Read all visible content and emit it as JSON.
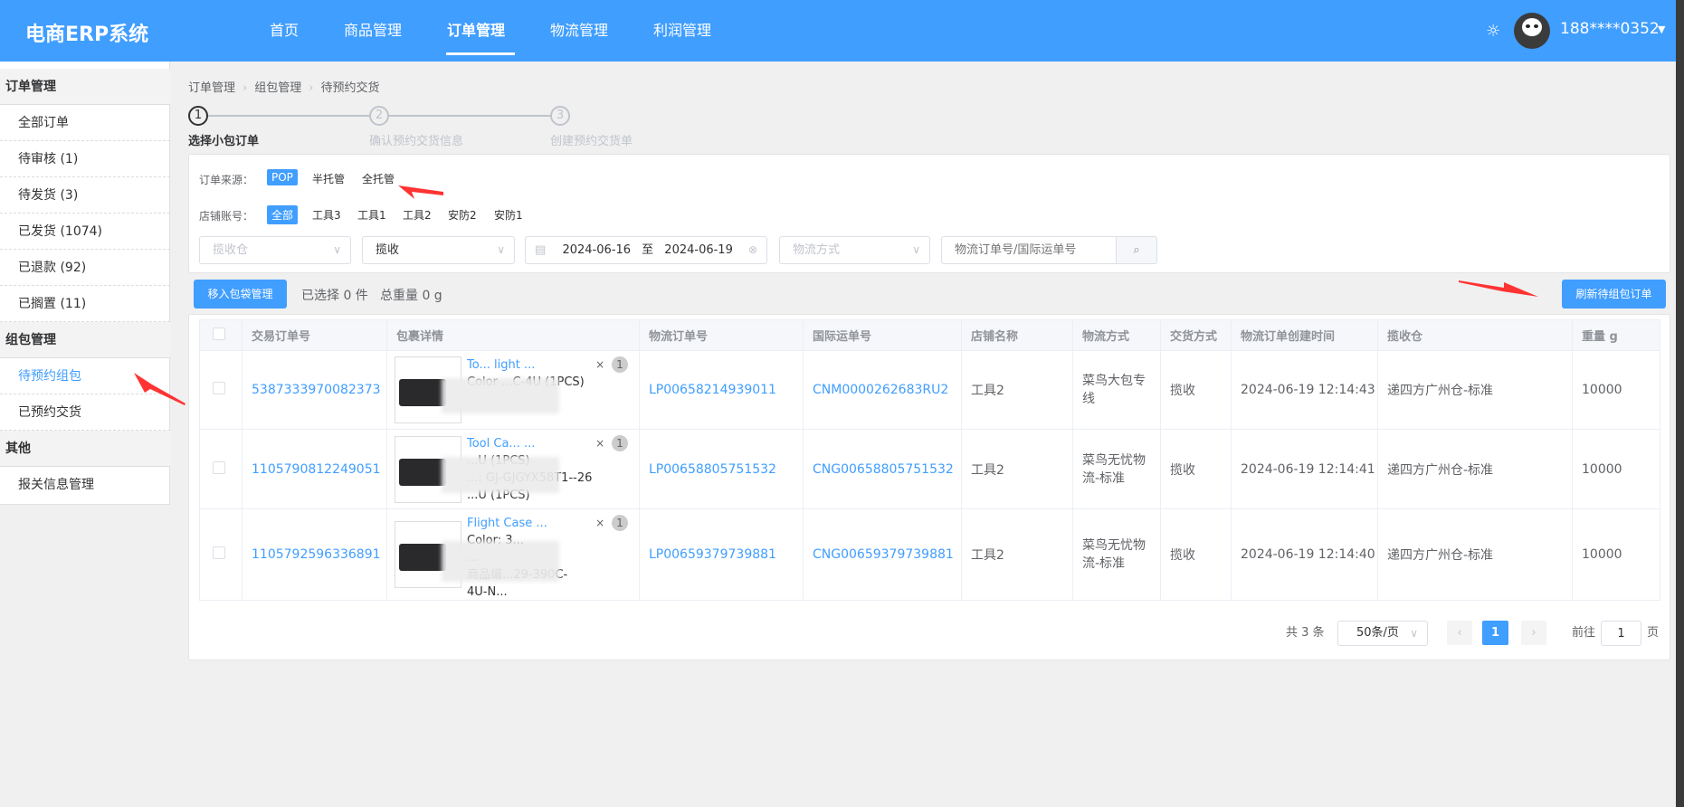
{
  "header": {
    "logo": "电商ERP系统",
    "nav": [
      "首页",
      "商品管理",
      "订单管理",
      "物流管理",
      "利润管理"
    ],
    "active_nav": "订单管理",
    "user": "188****0352",
    "theme_icon": "sun-icon",
    "accent": "#409eff"
  },
  "sidebar": {
    "groups": [
      {
        "label": "订单管理",
        "items": [
          "全部订单",
          "待审核 (1)",
          "待发货 (3)",
          "已发货 (1074)",
          "已退款 (92)",
          "已搁置 (11)"
        ]
      },
      {
        "label": "组包管理",
        "items": [
          "待预约组包",
          "已预约交货"
        ]
      },
      {
        "label": "其他",
        "items": [
          "报关信息管理"
        ]
      }
    ],
    "active": "待预约组包"
  },
  "breadcrumb": [
    "订单管理",
    "组包管理",
    "待预约交货"
  ],
  "steps": [
    {
      "num": "1",
      "label": "选择小包订单"
    },
    {
      "num": "2",
      "label": "确认预约交货信息"
    },
    {
      "num": "3",
      "label": "创建预约交货单"
    }
  ],
  "filters": {
    "source_label": "订单来源：",
    "sources": [
      "POP",
      "半托管",
      "全托管"
    ],
    "source_active": "POP",
    "shop_label": "店铺账号：",
    "shops": [
      "全部",
      "工具3",
      "工具1",
      "工具2",
      "安防2",
      "安防1"
    ],
    "shop_active": "全部",
    "warehouse_placeholder": "揽收仓",
    "delivery_value": "揽收",
    "date_start": "2024-06-16",
    "date_sep": "至",
    "date_end": "2024-06-19",
    "logistics_placeholder": "物流方式",
    "search_placeholder": "物流订单号/国际运单号"
  },
  "actions": {
    "move_button": "移入包袋管理",
    "selected": "已选择 0 件",
    "weight": "总重量 0 g",
    "refresh_button": "刷新待组包订单"
  },
  "table": {
    "columns": [
      "交易订单号",
      "包裹详情",
      "物流订单号",
      "国际运单号",
      "店铺名称",
      "物流方式",
      "交货方式",
      "物流订单创建时间",
      "揽收仓",
      "重量 g"
    ],
    "rows": [
      {
        "trade_no": "5387333970082373",
        "pkg_lines": [
          "To... light ...",
          "Color ...C-4U (1PCS)"
        ],
        "qty": "1",
        "logistics_no": "LP00658214939011",
        "intl_no": "CNM0000262683RU2",
        "shop": "工具2",
        "method": "菜鸟大包专线",
        "delivery": "揽收",
        "created": "2024-06-19 12:14:43",
        "warehouse": "递四方广州仓-标准",
        "weight": "10000"
      },
      {
        "trade_no": "1105790812249051",
        "pkg_lines": [
          "Tool Ca... ...",
          "...U (1PCS)",
          "...: GJ-GJGYX58T1--26",
          "...U (1PCS)"
        ],
        "qty": "1",
        "logistics_no": "LP00658805751532",
        "intl_no": "CNG00658805751532",
        "shop": "工具2",
        "method": "菜鸟无忧物流-标准",
        "delivery": "揽收",
        "created": "2024-06-19 12:14:41",
        "warehouse": "递四方广州仓-标准",
        "weight": "10000"
      },
      {
        "trade_no": "1105792596336891",
        "pkg_lines": [
          "Flight Case ...",
          "Color: 3...",
          "...",
          "商品编...29-390C-",
          "4U-N..."
        ],
        "qty": "1",
        "logistics_no": "LP00659379739881",
        "intl_no": "CNG00659379739881",
        "shop": "工具2",
        "method": "菜鸟无忧物流-标准",
        "delivery": "揽收",
        "created": "2024-06-19 12:14:40",
        "warehouse": "递四方广州仓-标准",
        "weight": "10000"
      }
    ]
  },
  "pagination": {
    "total": "共 3 条",
    "page_size": "50条/页",
    "current": "1",
    "goto_label": "前往",
    "goto_value": "1",
    "page_suffix": "页"
  }
}
